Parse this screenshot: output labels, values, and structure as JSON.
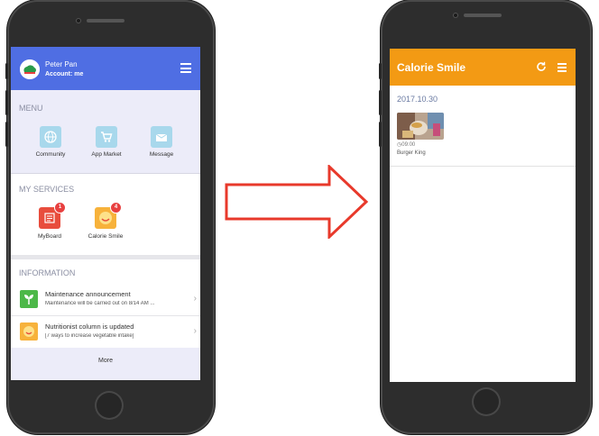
{
  "left_screen": {
    "header": {
      "user_name": "Peter Pan",
      "account": "Account: me",
      "avatar_icon": "cloud-avatar-icon",
      "menu_icon": "hamburger-menu-icon",
      "accent": "#4f6ee3"
    },
    "menu": {
      "title": "MENU",
      "items": [
        {
          "label": "Community",
          "icon": "globe-icon"
        },
        {
          "label": "App Market",
          "icon": "shopping-cart-icon"
        },
        {
          "label": "Message",
          "icon": "envelope-icon"
        }
      ]
    },
    "services": {
      "title": "MY SERVICES",
      "items": [
        {
          "label": "MyBoard",
          "badge": "1",
          "icon": "board-icon",
          "color": "#e84d3d"
        },
        {
          "label": "Calorie Smile",
          "badge": "4",
          "icon": "calorie-smile-app-icon",
          "color": "#f39a14"
        }
      ]
    },
    "information": {
      "title": "INFORMATION",
      "items": [
        {
          "title": "Maintenance announcement",
          "subtitle": "Maintenance will be carried out on 8/14 AM ...",
          "icon": "sprout-icon"
        },
        {
          "title": "Nutritionist column is updated",
          "subtitle": "[7 ways to increase vegetable intake]",
          "icon": "calorie-smile-app-icon"
        }
      ],
      "more_label": "More"
    }
  },
  "right_screen": {
    "header": {
      "title": "Calorie Smile",
      "refresh_icon": "refresh-icon",
      "menu_icon": "hamburger-menu-icon",
      "accent": "#f39a14"
    },
    "entry": {
      "date": "2017.10.30",
      "time": "09:00",
      "place": "Burger King",
      "clock_icon": "clock-icon",
      "photo": "food-photo"
    }
  },
  "arrow": {
    "direction": "right",
    "color": "#e8392b"
  }
}
